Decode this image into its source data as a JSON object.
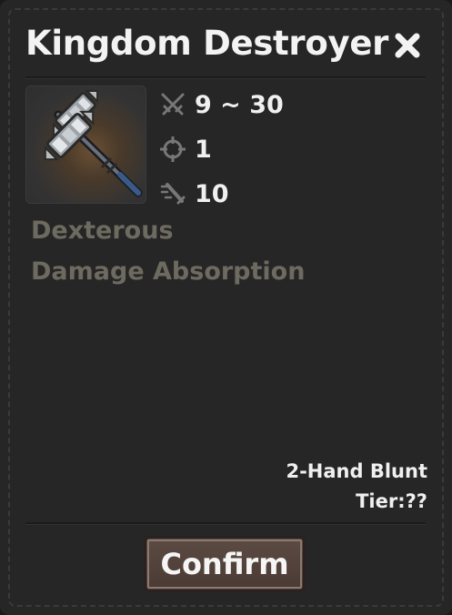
{
  "dialog": {
    "title": "Kingdom Destroyer",
    "stats": {
      "damage": "9 ~ 30",
      "range": "1",
      "speed": "10"
    },
    "traits": [
      "Dexterous",
      "Damage Absorption"
    ],
    "weapon_type": "2-Hand Blunt",
    "tier": "Tier:??",
    "confirm_label": "Confirm"
  },
  "icons": {
    "item": "double-headed-mace-icon",
    "damage": "crossed-swords-icon",
    "range": "crosshair-icon",
    "speed": "speed-icon",
    "close": "close-icon"
  },
  "colors": {
    "panel_bg": "#262626",
    "text_primary": "#f0f0f0",
    "text_muted": "#6d6a60",
    "button_bg": "#54443d"
  }
}
